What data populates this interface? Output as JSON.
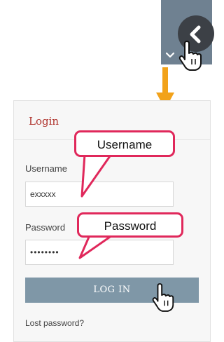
{
  "login": {
    "title": "Login",
    "username_label": "Username",
    "username_value": "exxxxx",
    "password_label": "Password",
    "password_value": "••••••••",
    "login_button": "LOG IN",
    "lost_password": "Lost password?"
  },
  "callouts": {
    "username": "Username",
    "password": "Password"
  },
  "icons": {
    "collapse": "chevron-left-icon",
    "expand": "chevron-down-icon",
    "pointer": "hand-cursor-icon",
    "arrow": "down-arrow-icon"
  },
  "colors": {
    "accent": "#b0352f",
    "button": "#7f97a7",
    "callout_border": "#e0285b",
    "arrow": "#f2a21a",
    "strip": "#6f8191"
  }
}
